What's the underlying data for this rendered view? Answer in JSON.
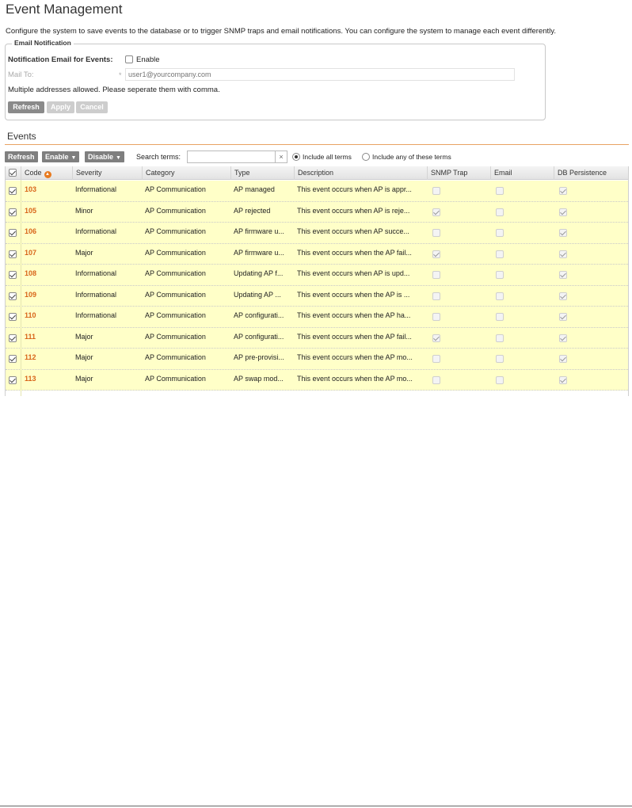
{
  "page": {
    "title": "Event Management",
    "intro": "Configure the system to save events to the database or to trigger SNMP traps and email notifications. You can configure the system to manage each event differently."
  },
  "email_notification": {
    "legend": "Email Notification",
    "notification_label": "Notification Email for Events:",
    "enable_label": "Enable",
    "enable_checked": false,
    "mail_to_label": "Mail To:",
    "required_mark": "*",
    "mail_to_placeholder": "user1@yourcompany.com",
    "mail_to_value": "",
    "note": "Multiple addresses allowed. Please seperate them with comma.",
    "buttons": {
      "refresh": "Refresh",
      "apply": "Apply",
      "cancel": "Cancel"
    }
  },
  "events": {
    "title": "Events",
    "toolbar": {
      "refresh": "Refresh",
      "enable": "Enable",
      "disable": "Disable",
      "search_label": "Search terms:",
      "search_value": "",
      "clear_glyph": "×",
      "radio_all": "Include all terms",
      "radio_any": "Include any of these terms",
      "selected_radio": "all"
    },
    "columns": [
      "Code",
      "Severity",
      "Category",
      "Type",
      "Description",
      "SNMP Trap",
      "Email",
      "DB Persistence"
    ],
    "sort_glyph": "▲",
    "rows": [
      {
        "code": "103",
        "severity": "Informational",
        "category": "AP Communication",
        "type": "AP managed",
        "description": "This event occurs when AP is appr...",
        "snmp": false,
        "email": false,
        "db": true
      },
      {
        "code": "105",
        "severity": "Minor",
        "category": "AP Communication",
        "type": "AP rejected",
        "description": "This event occurs when AP is reje...",
        "snmp": true,
        "email": false,
        "db": true
      },
      {
        "code": "106",
        "severity": "Informational",
        "category": "AP Communication",
        "type": "AP firmware u...",
        "description": "This event occurs when AP succe...",
        "snmp": false,
        "email": false,
        "db": true
      },
      {
        "code": "107",
        "severity": "Major",
        "category": "AP Communication",
        "type": "AP firmware u...",
        "description": "This event occurs when the AP fail...",
        "snmp": true,
        "email": false,
        "db": true
      },
      {
        "code": "108",
        "severity": "Informational",
        "category": "AP Communication",
        "type": "Updating AP f...",
        "description": "This event occurs when AP is upd...",
        "snmp": false,
        "email": false,
        "db": true
      },
      {
        "code": "109",
        "severity": "Informational",
        "category": "AP Communication",
        "type": "Updating AP ...",
        "description": "This event occurs when the AP is ...",
        "snmp": false,
        "email": false,
        "db": true
      },
      {
        "code": "110",
        "severity": "Informational",
        "category": "AP Communication",
        "type": "AP configurati...",
        "description": "This event occurs when the AP ha...",
        "snmp": false,
        "email": false,
        "db": true
      },
      {
        "code": "111",
        "severity": "Major",
        "category": "AP Communication",
        "type": "AP configurati...",
        "description": "This event occurs when the AP fail...",
        "snmp": true,
        "email": false,
        "db": true
      },
      {
        "code": "112",
        "severity": "Major",
        "category": "AP Communication",
        "type": "AP pre-provisi...",
        "description": "This event occurs when the AP mo...",
        "snmp": false,
        "email": false,
        "db": true
      },
      {
        "code": "113",
        "severity": "Major",
        "category": "AP Communication",
        "type": "AP swap mod...",
        "description": "This event occurs when the AP mo...",
        "snmp": false,
        "email": false,
        "db": true
      }
    ]
  }
}
